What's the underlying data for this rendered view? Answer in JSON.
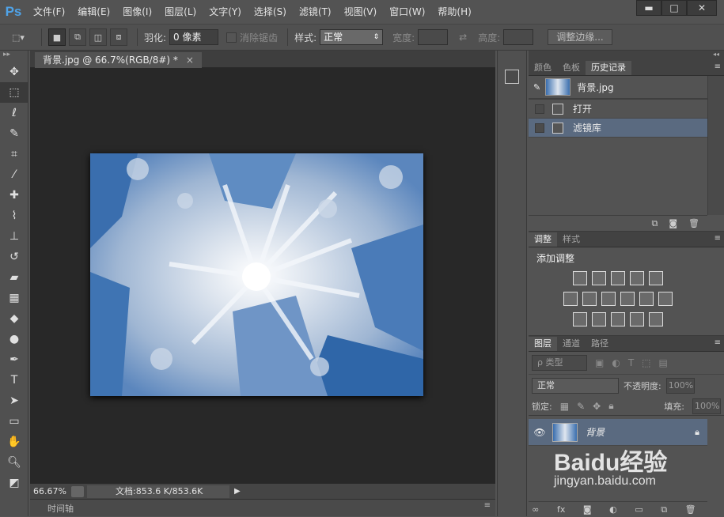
{
  "app": {
    "logo": "Ps"
  },
  "menu": [
    "文件(F)",
    "编辑(E)",
    "图像(I)",
    "图层(L)",
    "文字(Y)",
    "选择(S)",
    "滤镜(T)",
    "视图(V)",
    "窗口(W)",
    "帮助(H)"
  ],
  "window_controls": {
    "minimize": "▬",
    "maximize": "□",
    "close": "✕"
  },
  "options": {
    "feather_label": "羽化:",
    "feather_value": "0 像素",
    "antialias_label": "消除锯齿",
    "style_label": "样式:",
    "style_value": "正常",
    "width_label": "宽度:",
    "height_label": "高度:",
    "refine_edge_button": "调整边缘..."
  },
  "document": {
    "tab_title": "背景.jpg @ 66.7%(RGB/8#) *",
    "zoom": "66.67%",
    "doc_info": "文档:853.6 K/853.6K"
  },
  "timeline": {
    "label": "时间轴"
  },
  "history_panel": {
    "tabs": [
      "颜色",
      "色板",
      "历史记录"
    ],
    "active_tab": "历史记录",
    "snapshot": "背景.jpg",
    "items": [
      {
        "label": "打开",
        "selected": false
      },
      {
        "label": "滤镜库",
        "selected": true
      }
    ]
  },
  "adjustments_panel": {
    "tabs": [
      "调整",
      "样式"
    ],
    "active_tab": "调整",
    "title": "添加调整"
  },
  "layers_panel": {
    "tabs": [
      "图层",
      "通道",
      "路径"
    ],
    "active_tab": "图层",
    "filter_label": "ρ 类型",
    "blend_mode": "正常",
    "opacity_label": "不透明度:",
    "opacity_value": "100%",
    "lock_label": "锁定:",
    "fill_label": "填充:",
    "fill_value": "100%",
    "layers": [
      {
        "name": "背景",
        "visible": true,
        "locked": true
      }
    ]
  },
  "watermark": {
    "brand": "Baidu经验",
    "url": "jingyan.baidu.com"
  },
  "colors": {
    "accent": "#4fa3e8",
    "selection": "#5a6a80",
    "canvas_bg": "#282828"
  }
}
